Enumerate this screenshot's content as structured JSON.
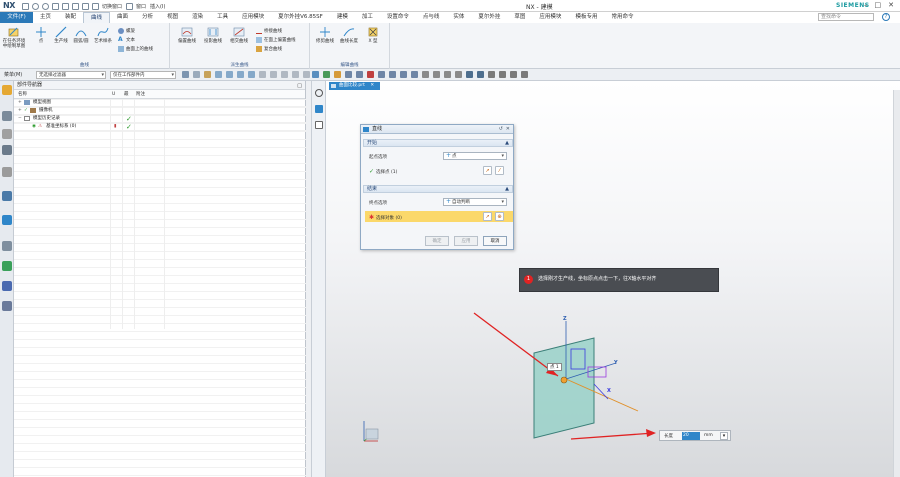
{
  "titlebar": {
    "logo": "NX",
    "quick_access_text_1": "切换窗口",
    "quick_access_text_2": "窗口",
    "quick_access_text_3": "插入(I)",
    "window_title": "NX - 建模",
    "brand": "SIEMENS",
    "min_label": "–",
    "max_label": "□",
    "close_label": "✕"
  },
  "tabs": {
    "file": "文件(F)",
    "items": [
      "主页",
      "装配",
      "曲线",
      "曲面",
      "分析",
      "视图",
      "渲染",
      "工具",
      "应用模块",
      "夏尔外挂V6.85SF",
      "建模",
      "加工",
      "设置命令",
      "点与线",
      "实体",
      "夏尔外挂",
      "草图",
      "应用模块",
      "模板专用",
      "常用命令"
    ],
    "active_index": 2,
    "search_placeholder": "查找命令"
  },
  "ribbon": {
    "group1": {
      "label": "直线和圆弧",
      "buttons": [
        "点",
        "生产线",
        "圆弧/圆",
        "艺术样条"
      ],
      "side_btn": "在任务环境中绘制草图"
    },
    "group1_small": [
      "螺旋",
      "文本",
      "曲面上的曲线"
    ],
    "group1_footer": "曲线",
    "group2": {
      "label": "派生曲线",
      "buttons": [
        "偏置曲线",
        "投影曲线",
        "相交曲线"
      ],
      "small": [
        "桥接曲线",
        "在面上偏置曲线",
        "复合曲线"
      ]
    },
    "group3": {
      "label": "编辑曲线",
      "buttons": [
        "修剪曲线",
        "曲线长度",
        "X 型"
      ]
    }
  },
  "selbar": {
    "menu": "菜单(M)",
    "filter": "无选择过滤器",
    "scope": "仅在工作部件内"
  },
  "navigator": {
    "title": "部件导航器",
    "columns": {
      "name": "名称",
      "up": "U",
      "latest": "最",
      "note": "附注"
    },
    "rows": [
      {
        "label": "模型视图"
      },
      {
        "label": "摄像机"
      },
      {
        "label": "模型历史记录"
      },
      {
        "label": "基准坐标系 (0)"
      }
    ]
  },
  "graphics": {
    "tab_label": "曲面比较.prt"
  },
  "dialog": {
    "title": "直线",
    "start_section": "开始",
    "start_option_label": "起点选项",
    "start_option_value": "点",
    "start_select": "选择点 (1)",
    "end_section": "结束",
    "end_option_label": "终点选项",
    "end_option_value": "自动判断",
    "end_select": "选择对象 (0)",
    "btn_ok": "确定",
    "btn_apply": "应用",
    "btn_cancel": "取消"
  },
  "tooltip": {
    "number": "1",
    "text": "选择刚才生产线，坐标原点点击一下，往X轴水平对齐"
  },
  "viewport": {
    "point_label": "点 1",
    "axis_z": "Z",
    "axis_y": "Y",
    "axis_x": "X"
  },
  "length_input": {
    "label": "长度",
    "value": "20",
    "unit": "mm"
  }
}
